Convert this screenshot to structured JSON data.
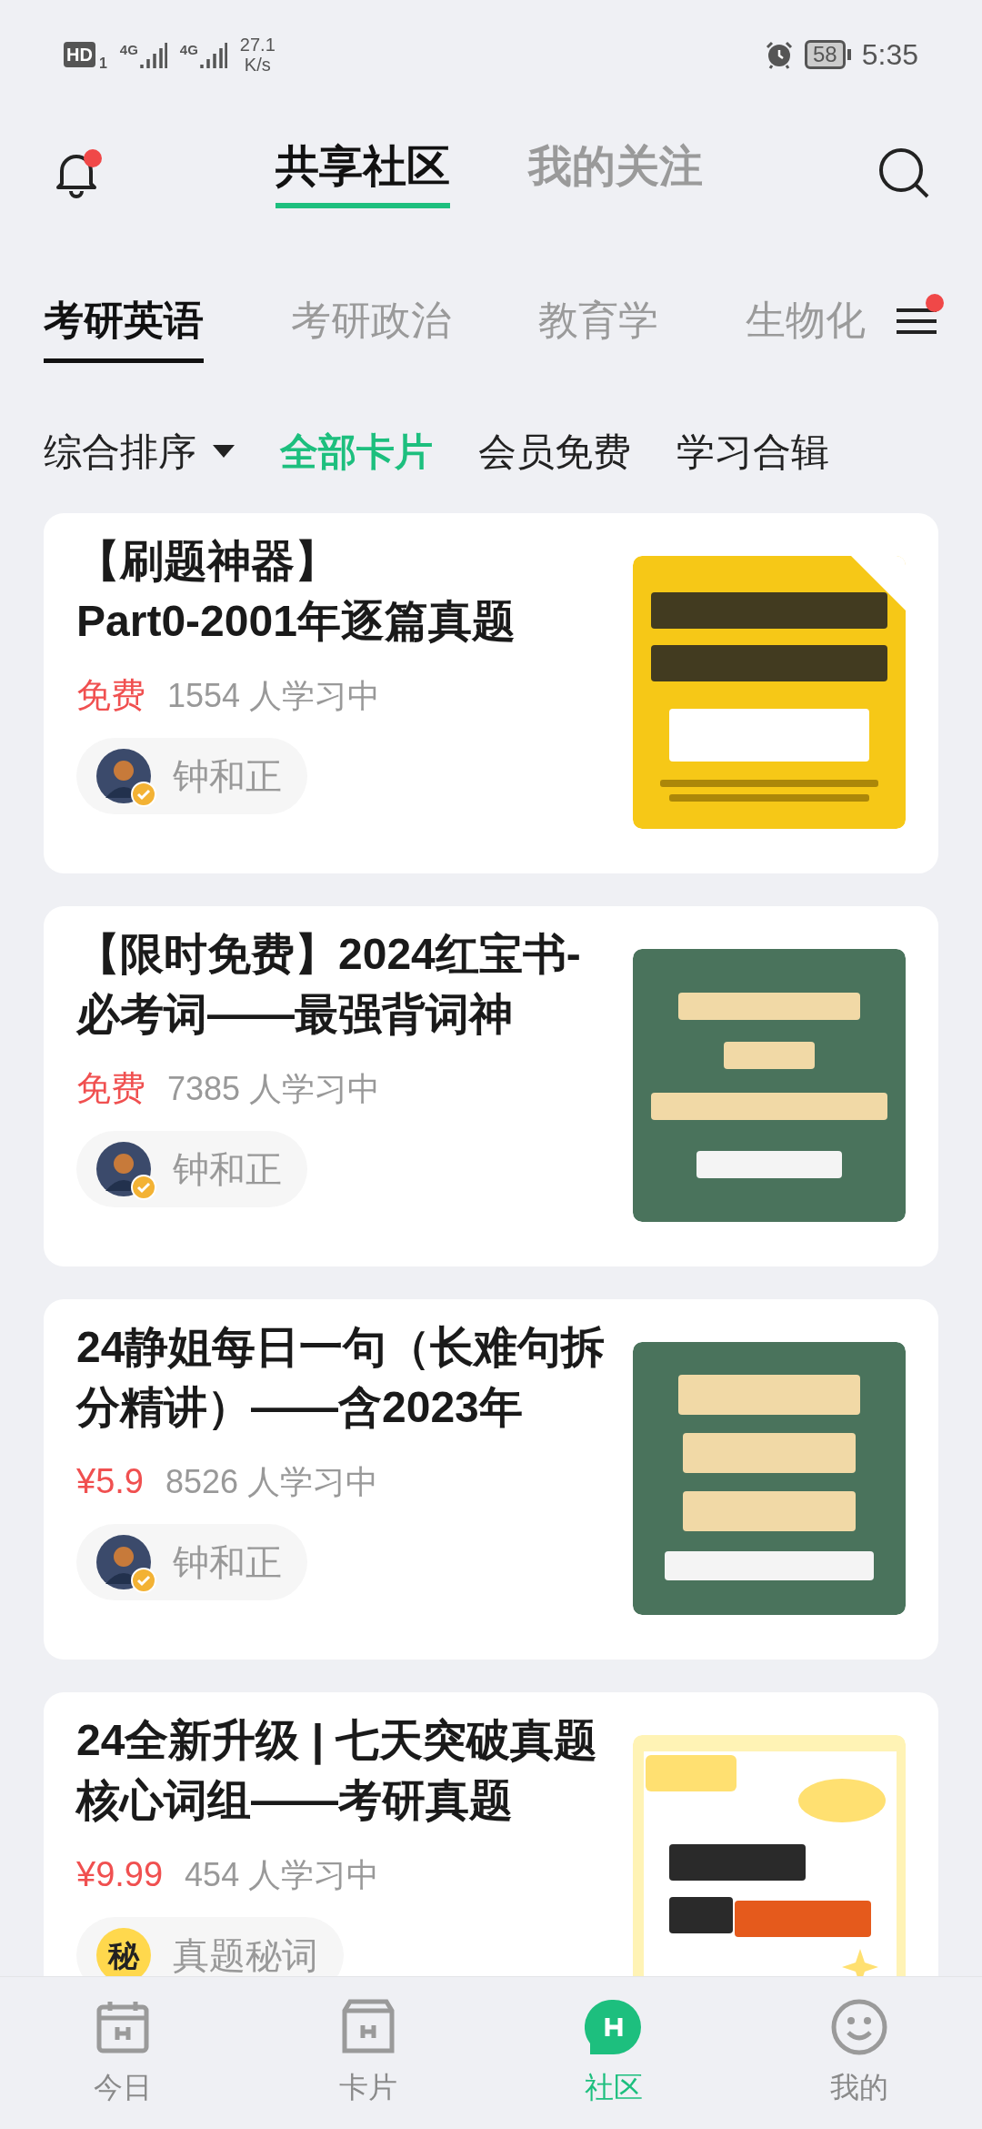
{
  "status_bar": {
    "hd": "HD",
    "sim": "1",
    "net1": "4G",
    "net2": "4G",
    "speed": "27.1",
    "speed_unit": "K/s",
    "battery": "58",
    "time": "5:35"
  },
  "header": {
    "bell_badge": true,
    "tabs": [
      {
        "label": "共享社区",
        "selected": true
      },
      {
        "label": "我的关注",
        "selected": false
      }
    ]
  },
  "categories": {
    "menu_badge": true,
    "items": [
      {
        "label": "考研英语",
        "selected": true
      },
      {
        "label": "考研政治",
        "selected": false
      },
      {
        "label": "教育学",
        "selected": false
      },
      {
        "label": "生物化",
        "selected": false
      }
    ]
  },
  "filters": {
    "sort": "综合排序",
    "items": [
      {
        "label": "全部卡片",
        "selected": true
      },
      {
        "label": "会员免费",
        "selected": false
      },
      {
        "label": "学习合辑",
        "selected": false
      }
    ]
  },
  "cards": [
    {
      "title": "【刷题神器】\nPart0-2001年逐篇真题",
      "price": "免费",
      "learners": "1554 人学习中",
      "author": {
        "name": "钟和正"
      }
    },
    {
      "title": "【限时免费】2024红宝书-必考词——最强背词神",
      "price": "免费",
      "learners": "7385 人学习中",
      "author": {
        "name": "钟和正"
      }
    },
    {
      "title": "24静姐每日一句（长难句拆分精讲）——含2023年",
      "price": "¥5.9",
      "learners": "8526 人学习中",
      "author": {
        "name": "钟和正"
      }
    },
    {
      "title": "24全新升级 | 七天突破真题核心词组——考研真题",
      "price": "¥9.99",
      "learners": "454 人学习中",
      "author": {
        "kind": "letter",
        "letter": "秘",
        "name": "真题秘词"
      }
    }
  ],
  "nav": [
    {
      "kind": "calendar",
      "label": "今日",
      "selected": false
    },
    {
      "kind": "box",
      "label": "卡片",
      "selected": false
    },
    {
      "kind": "chat",
      "label": "社区",
      "selected": true
    },
    {
      "kind": "smile",
      "label": "我的",
      "selected": false
    }
  ]
}
